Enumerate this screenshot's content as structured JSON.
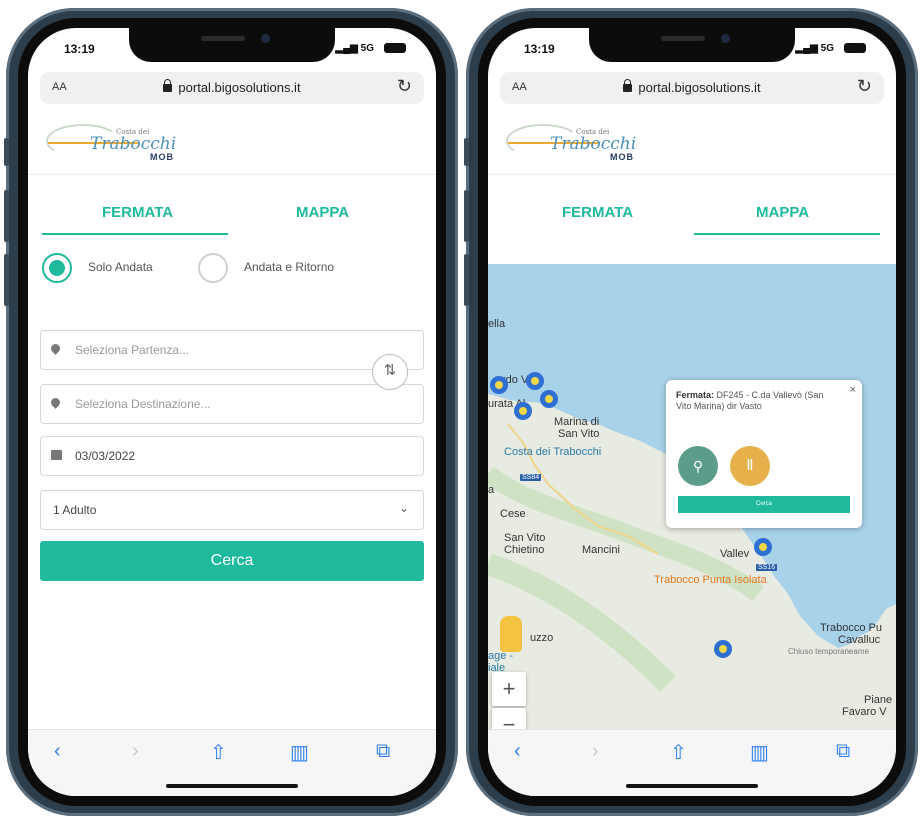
{
  "colors": {
    "accent": "#1fb99e",
    "phone_frame": "#2c3e4c",
    "map_sea": "#a8d1ea",
    "map_land": "#e7ebe1",
    "stop_marker": "#2e6fd4"
  },
  "status": {
    "time": "13:19",
    "network": "5G"
  },
  "browser": {
    "text_size_label": "AA",
    "url": "portal.bigosolutions.it",
    "reload_icon": "reload-icon"
  },
  "logo": {
    "small_text": "Costa dei",
    "brand": "Trabocchi",
    "sub": "MOB"
  },
  "tabs": [
    "FERMATA",
    "MAPPA"
  ],
  "trip_type": {
    "one_way": "Solo Andata",
    "round_trip": "Andata e Ritorno",
    "selected": "Solo Andata"
  },
  "form": {
    "departure_placeholder": "Seleziona Partenza...",
    "destination_placeholder": "Seleziona Destinazione...",
    "date": "03/03/2022",
    "passengers": "1 Adulto",
    "search_label": "Cerca"
  },
  "map": {
    "labels": [
      "ella",
      "rdo V",
      "urata Al",
      "Marina di",
      "San Vito",
      "Costa dei Trabocchi",
      "SS84",
      "a",
      "Cese",
      "San Vito",
      "Chietino",
      "Mancini",
      "Vallev",
      "SS16",
      "Trabocco Punta Isolata",
      "uzzo",
      "age -",
      "iale",
      "Trabocco Pu",
      "Cavalluc",
      "Chiuso temporaneame",
      "Piane",
      "Favaro V"
    ],
    "popup": {
      "title": "Fermata:",
      "text": "DF245 - C.da Vallevò (San Vito Marina) dir Vasto",
      "button": "Cerca"
    },
    "zoom_in": "+",
    "zoom_out": "−"
  },
  "toolbar": [
    "back-icon",
    "forward-icon",
    "share-icon",
    "bookmarks-icon",
    "tabs-icon"
  ]
}
